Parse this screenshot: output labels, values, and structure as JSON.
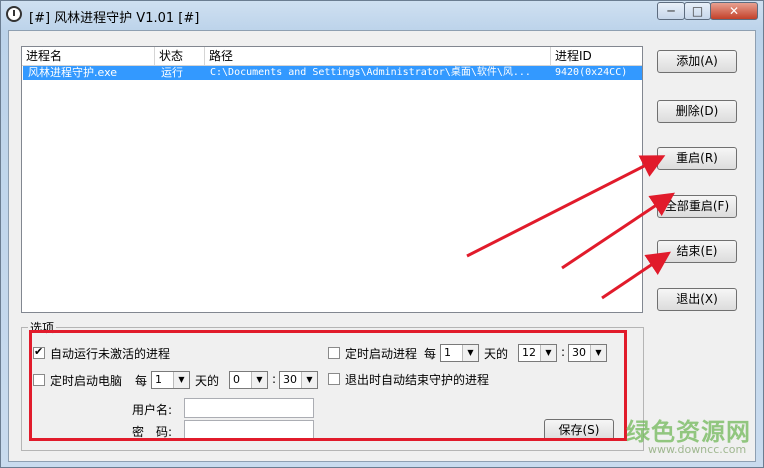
{
  "window": {
    "title": "[#] 风林进程守护 V1.01 [#]",
    "min_label": "─",
    "max_label": "□",
    "close_label": "✕"
  },
  "list": {
    "columns": [
      "进程名",
      "状态",
      "路径",
      "进程ID"
    ],
    "rows": [
      {
        "name": "风林进程守护.exe",
        "status": "运行",
        "path": "C:\\Documents and Settings\\Administrator\\桌面\\软件\\风...",
        "pid": "9420(0x24CC)"
      }
    ]
  },
  "buttons": {
    "add": "添加(A)",
    "delete": "删除(D)",
    "restart": "重启(R)",
    "restart_all": "全部重启(F)",
    "end": "结束(E)",
    "exit": "退出(X)",
    "save": "保存(S)"
  },
  "options": {
    "group_label": "选项",
    "auto_run_inactive": {
      "label": "自动运行未激活的进程",
      "checked": true
    },
    "timed_start_process": {
      "label": "定时启动进程",
      "every": "每",
      "days_value": "1",
      "days_label": "天的",
      "hour": "12",
      "colon": ":",
      "minute": "30",
      "checked": false
    },
    "timed_start_pc": {
      "label": "定时启动电脑",
      "every": "每",
      "days_value": "1",
      "days_label": "天的",
      "hour": "0",
      "colon": ":",
      "minute": "30",
      "checked": false
    },
    "end_on_exit": {
      "label": "退出时自动结束守护的进程",
      "checked": false
    },
    "username_label": "用户名:",
    "password_label": "密　码:",
    "username_value": "",
    "password_value": ""
  },
  "watermark": {
    "text": "绿色资源网",
    "url": "www.downcc.com"
  },
  "colors": {
    "selection": "#3399ff",
    "annotation_red": "#e11b2b",
    "watermark_green": "#72b95a"
  }
}
